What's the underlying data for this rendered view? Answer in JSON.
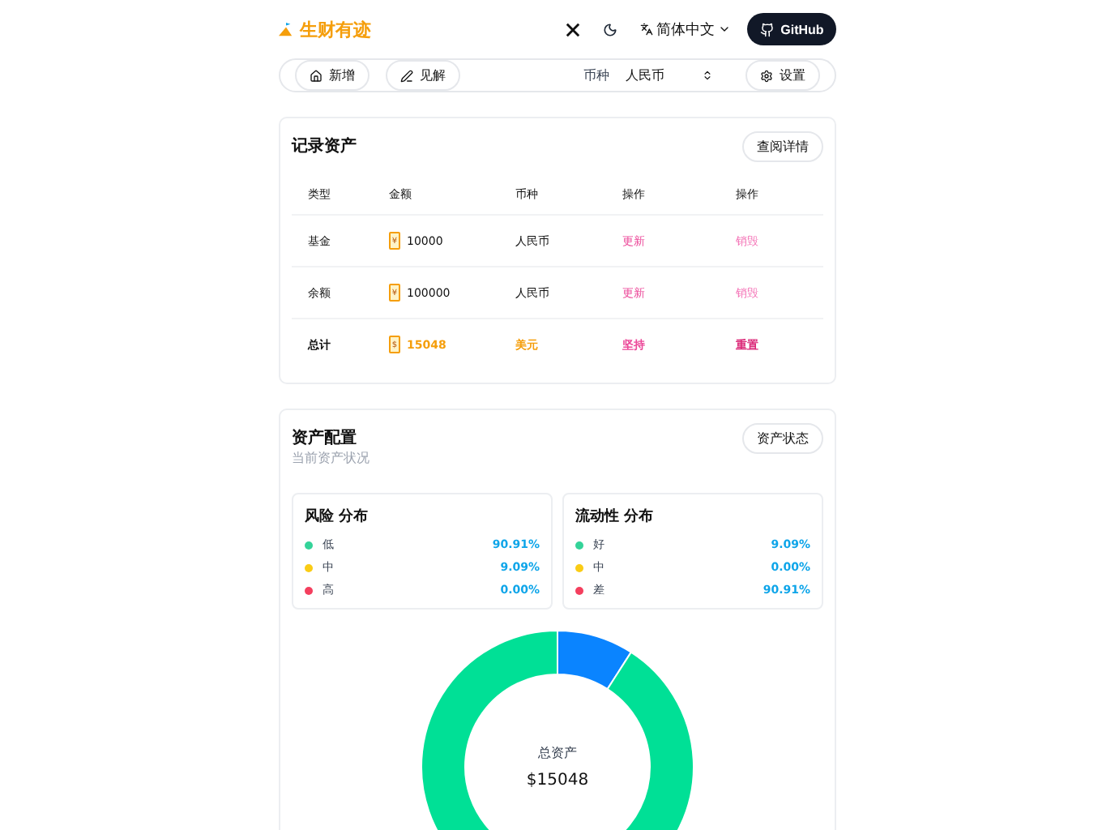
{
  "header": {
    "logo": "生财有迹",
    "language": "简体中文",
    "github": "GitHub"
  },
  "toolbar": {
    "add": "新增",
    "insight": "见解",
    "currency_label": "币种",
    "currency_value": "人民币",
    "settings": "设置"
  },
  "records": {
    "title": "记录资产",
    "details_button": "查阅详情",
    "columns": [
      "类型",
      "金额",
      "币种",
      "操作",
      "操作"
    ],
    "rows": [
      {
        "kind": "item",
        "type": "基金",
        "symbol": "¥",
        "amount": "10000",
        "currency": "人民币",
        "action_1": "更新",
        "action_2": "销毁"
      },
      {
        "kind": "item",
        "type": "余额",
        "symbol": "¥",
        "amount": "100000",
        "currency": "人民币",
        "action_1": "更新",
        "action_2": "销毁"
      },
      {
        "kind": "total",
        "type": "总计",
        "symbol": "$",
        "amount": "15048",
        "currency": "美元",
        "action_1": "坚持",
        "action_2": "重置"
      }
    ]
  },
  "allocation": {
    "title": "资产配置",
    "subtitle": "当前资产状况",
    "status_button": "资产状态",
    "panels": [
      {
        "title": "风险 分布",
        "items": [
          {
            "label": "低",
            "value": "90.91%",
            "color": "#34d399"
          },
          {
            "label": "中",
            "value": "9.09%",
            "color": "#facc15"
          },
          {
            "label": "高",
            "value": "0.00%",
            "color": "#f43f5e"
          }
        ]
      },
      {
        "title": "流动性 分布",
        "items": [
          {
            "label": "好",
            "value": "9.09%",
            "color": "#34d399"
          },
          {
            "label": "中",
            "value": "0.00%",
            "color": "#facc15"
          },
          {
            "label": "差",
            "value": "90.91%",
            "color": "#f43f5e"
          }
        ]
      }
    ],
    "donut": {
      "label": "总资产",
      "value": "$15048"
    }
  }
}
